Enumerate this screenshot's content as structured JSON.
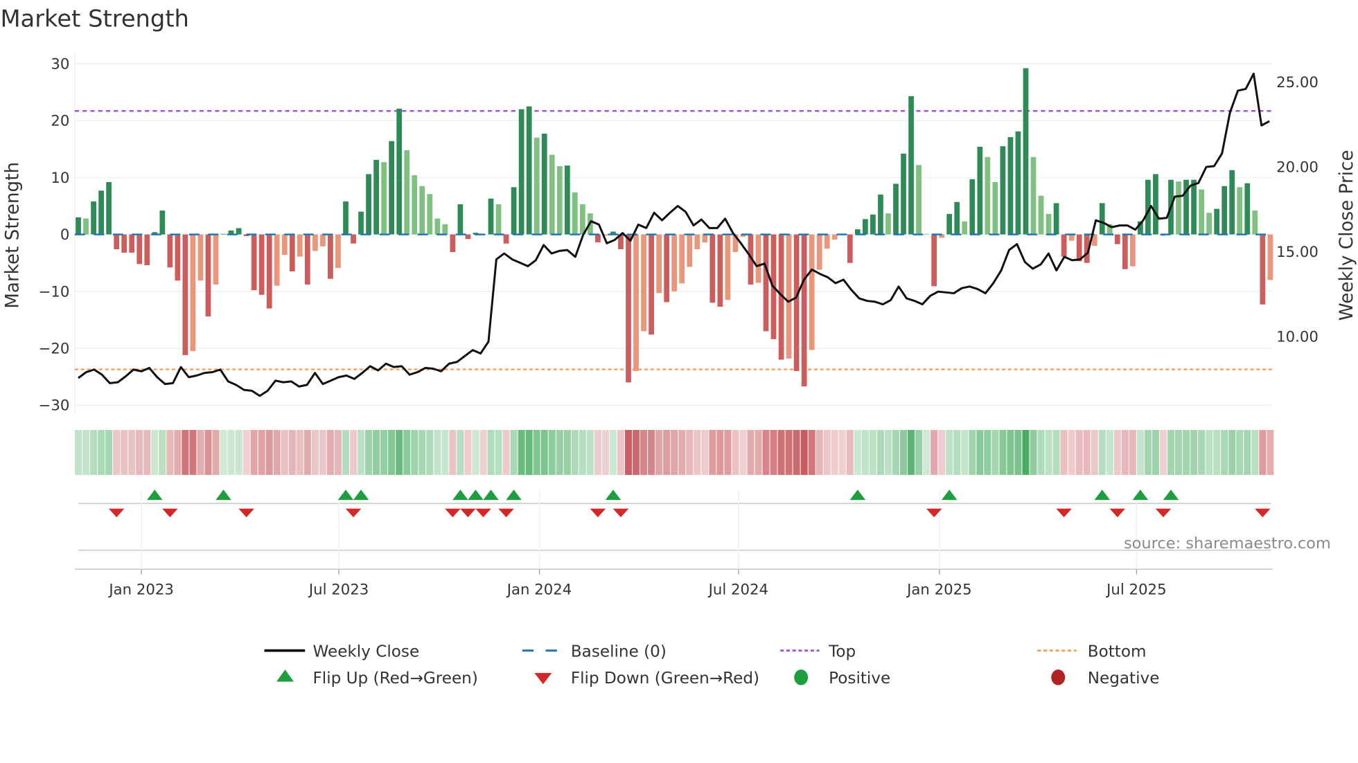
{
  "chart_data": {
    "type": "bar",
    "title": "Market Strength",
    "ylabel": "Market Strength",
    "y2label": "Weekly Close Price",
    "ylim": [
      -30,
      30
    ],
    "yticks": [
      "30",
      "20",
      "10",
      "0",
      "−10",
      "−20",
      "−30"
    ],
    "ytick_values": [
      30,
      20,
      10,
      0,
      -10,
      -20,
      -30
    ],
    "y2ticks": [
      "25.00",
      "20.00",
      "15.00",
      "10.00"
    ],
    "y2tick_values": [
      25,
      20,
      15,
      10
    ],
    "xticks": [
      {
        "label": "Jan 2023",
        "week": 8.26
      },
      {
        "label": "Jul 2023",
        "week": 34.1
      },
      {
        "label": "Jan 2024",
        "week": 60.35
      },
      {
        "label": "Jul 2024",
        "week": 86.4
      },
      {
        "label": "Jan 2025",
        "week": 112.7
      },
      {
        "label": "Jul 2025",
        "week": 138.5
      }
    ],
    "top_level": 21.7,
    "bottom_level": -23.7,
    "baseline": 0,
    "strength": [
      3.0,
      2.8,
      5.8,
      7.7,
      9.2,
      -2.6,
      -3.2,
      -3.2,
      -5.2,
      -5.4,
      0.4,
      4.2,
      -5.8,
      -8.1,
      -21.2,
      -20.5,
      -8.1,
      -14.4,
      -8.8,
      0.1,
      0.7,
      1.1,
      -0.3,
      -9.8,
      -10.6,
      -13.0,
      -9.0,
      -3.6,
      -6.5,
      -3.9,
      -8.8,
      -2.9,
      -2.1,
      -7.8,
      -5.9,
      5.8,
      -1.6,
      4.0,
      10.6,
      13.1,
      12.7,
      16.4,
      22.1,
      14.8,
      10.4,
      8.5,
      7.1,
      2.8,
      1.8,
      -3.1,
      5.3,
      -0.8,
      0.3,
      -0.1,
      6.3,
      5.3,
      -1.6,
      8.3,
      22.0,
      22.5,
      17.0,
      17.7,
      14.0,
      12.0,
      12.1,
      7.4,
      5.3,
      3.7,
      -1.4,
      -0.2,
      0.5,
      -2.6,
      -26.0,
      -24.0,
      -17.0,
      -17.6,
      -10.3,
      -11.9,
      -10.0,
      -8.6,
      -5.7,
      -2.6,
      -1.4,
      -12.0,
      -12.7,
      -11.5,
      -3.1,
      -0.4,
      -8.8,
      -8.5,
      -17.0,
      -18.4,
      -22.0,
      -21.8,
      -24.0,
      -26.7,
      -20.3,
      -6.2,
      -2.5,
      -0.9,
      -0.1,
      -5.0,
      0.9,
      2.7,
      3.5,
      7.0,
      3.7,
      8.9,
      14.2,
      24.3,
      12.2,
      0.1,
      -9.1,
      -0.6,
      3.6,
      5.7,
      2.3,
      9.7,
      15.4,
      13.6,
      9.2,
      15.5,
      17.1,
      18.1,
      29.2,
      13.6,
      6.8,
      3.6,
      5.5,
      -3.9,
      -1.1,
      -4.7,
      -5.0,
      -2.0,
      5.5,
      1.8,
      -1.7,
      -6.1,
      -5.6,
      2.3,
      9.6,
      10.6,
      -0.2,
      9.6,
      9.3,
      9.6,
      9.6,
      7.9,
      3.8,
      4.5,
      8.5,
      11.3,
      8.3,
      9.0,
      4.2,
      -12.3,
      -8.0
    ],
    "weekly_close": [
      7.55,
      7.9,
      8.05,
      7.75,
      7.25,
      7.3,
      7.65,
      8.05,
      7.95,
      8.15,
      7.6,
      7.2,
      7.25,
      8.2,
      7.6,
      7.7,
      7.85,
      7.9,
      8.05,
      7.35,
      7.15,
      6.85,
      6.8,
      6.5,
      6.8,
      7.4,
      7.3,
      7.35,
      7.05,
      7.15,
      7.85,
      7.2,
      7.4,
      7.6,
      7.7,
      7.5,
      7.85,
      8.25,
      8.0,
      8.4,
      8.2,
      8.25,
      7.75,
      7.9,
      8.15,
      8.1,
      7.95,
      8.4,
      8.5,
      8.85,
      9.2,
      9.0,
      9.7,
      14.55,
      14.9,
      14.55,
      14.35,
      14.15,
      14.5,
      15.4,
      14.9,
      15.05,
      15.1,
      14.7,
      16.0,
      16.8,
      16.6,
      15.5,
      15.7,
      16.1,
      15.65,
      16.6,
      16.4,
      17.3,
      16.85,
      17.3,
      17.7,
      17.35,
      16.55,
      16.9,
      16.4,
      16.4,
      16.95,
      16.1,
      15.5,
      14.85,
      14.15,
      14.3,
      13.0,
      12.5,
      12.05,
      12.3,
      13.35,
      13.95,
      13.7,
      13.5,
      13.15,
      13.35,
      12.75,
      12.25,
      12.1,
      12.05,
      11.9,
      12.15,
      12.95,
      12.25,
      12.1,
      11.9,
      12.4,
      12.65,
      12.6,
      12.55,
      12.85,
      12.95,
      12.8,
      12.55,
      13.15,
      13.9,
      15.1,
      15.45,
      14.4,
      14.0,
      14.25,
      14.9,
      13.9,
      14.7,
      14.5,
      14.55,
      14.95,
      16.85,
      16.7,
      16.45,
      16.55,
      16.55,
      16.3,
      16.85,
      17.7,
      16.95,
      17.0,
      18.25,
      18.3,
      18.9,
      19.05,
      20.0,
      20.05,
      20.8,
      23.2,
      24.5,
      24.6,
      25.5,
      22.45,
      22.7
    ],
    "price_ylim": [
      5.95,
      26.3
    ],
    "flip_up_weeks": [
      10,
      19,
      35,
      37,
      50,
      52,
      54,
      57,
      70,
      102,
      114,
      134,
      139,
      143
    ],
    "flip_down_weeks": [
      5,
      12,
      22,
      36,
      49,
      51,
      53,
      56,
      68,
      71,
      112,
      129,
      136,
      142,
      155
    ],
    "legend_placement": "bottom",
    "legend": [
      {
        "key": "weekly_close",
        "label": "Weekly Close"
      },
      {
        "key": "baseline",
        "label": "Baseline (0)"
      },
      {
        "key": "top",
        "label": "Top"
      },
      {
        "key": "bottom",
        "label": "Bottom"
      },
      {
        "key": "flip_up",
        "label": "Flip Up (Red→Green)"
      },
      {
        "key": "flip_down",
        "label": "Flip Down (Green→Red)"
      },
      {
        "key": "positive",
        "label": "Positive"
      },
      {
        "key": "negative",
        "label": "Negative"
      }
    ]
  },
  "source": "source: sharemaestro.com",
  "colors": {
    "strong_positive": "#2e8b57",
    "weak_positive": "#80c080",
    "strong_negative": "#cd5c5c",
    "weak_negative": "#e9967a",
    "price_line": "#111111",
    "baseline": "#1f77b4",
    "top": "#9b59d6",
    "bottom": "#f4a460",
    "flip_up": "#1e9e3e",
    "flip_down": "#d62728",
    "positive": "#1e9e3e",
    "negative": "#b22222"
  }
}
